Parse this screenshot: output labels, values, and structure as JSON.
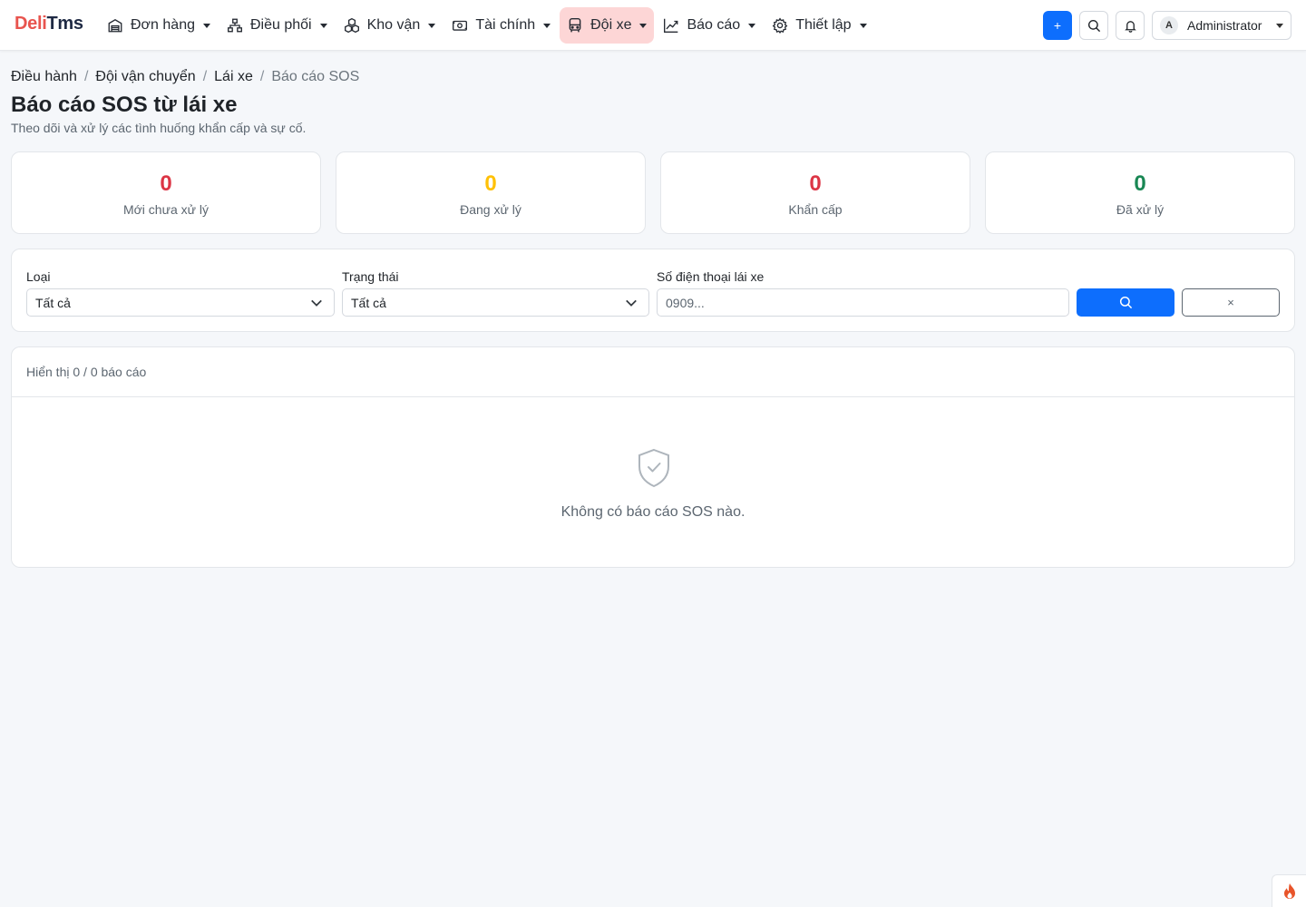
{
  "brand": {
    "part1": "Deli",
    "part2": "Tms"
  },
  "nav": {
    "items": [
      {
        "label": "Đơn hàng",
        "icon": "warehouse-icon"
      },
      {
        "label": "Điều phối",
        "icon": "network-icon"
      },
      {
        "label": "Kho vận",
        "icon": "boxes-icon"
      },
      {
        "label": "Tài chính",
        "icon": "cash-icon"
      },
      {
        "label": "Đội xe",
        "icon": "bus-icon",
        "active": true
      },
      {
        "label": "Báo cáo",
        "icon": "graph-up-icon"
      },
      {
        "label": "Thiết lập",
        "icon": "gear-icon"
      }
    ],
    "plus_label": "+",
    "user": {
      "avatar_initial": "A",
      "name": "Administrator"
    }
  },
  "breadcrumb": {
    "items": [
      "Điều hành",
      "Đội vận chuyển",
      "Lái xe",
      "Báo cáo SOS"
    ],
    "separator": "/"
  },
  "page": {
    "title": "Báo cáo SOS từ lái xe",
    "subtitle": "Theo dõi và xử lý các tình huống khẩn cấp và sự cố."
  },
  "stats": [
    {
      "value": "0",
      "label": "Mới chưa xử lý",
      "color": "#dc3545"
    },
    {
      "value": "0",
      "label": "Đang xử lý",
      "color": "#ffc107"
    },
    {
      "value": "0",
      "label": "Khẩn cấp",
      "color": "#dc3545"
    },
    {
      "value": "0",
      "label": "Đã xử lý",
      "color": "#198754"
    }
  ],
  "filter": {
    "type_label": "Loại",
    "type_value": "Tất cả",
    "status_label": "Trạng thái",
    "status_value": "Tất cả",
    "phone_label": "Số điện thoại lái xe",
    "phone_placeholder": "0909...",
    "phone_value": "",
    "clear_label": "×"
  },
  "results": {
    "summary": "Hiển thị 0 / 0 báo cáo",
    "empty_text": "Không có báo cáo SOS nào."
  },
  "colors": {
    "accent": "#0d6efd",
    "brand_red": "#e8544e",
    "active_nav_bg": "#fdd6d6"
  }
}
